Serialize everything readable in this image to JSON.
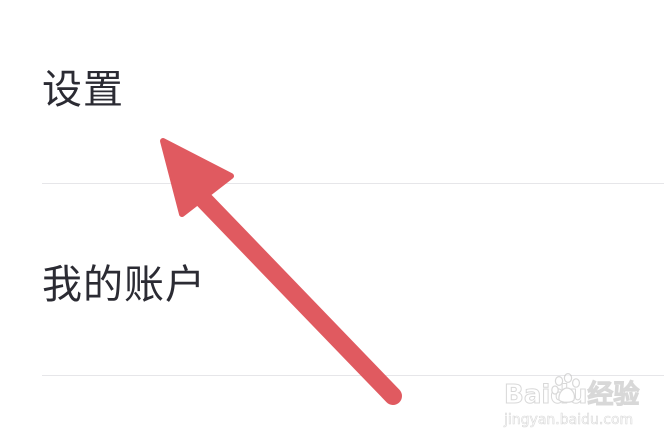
{
  "menu": {
    "items": [
      {
        "label": "设置"
      },
      {
        "label": "我的账户"
      }
    ]
  },
  "annotation": {
    "arrow_color": "#e05a60"
  },
  "watermark": {
    "brand_text": "Baidu经验",
    "url_text": "jingyan.baidu.com"
  },
  "colors": {
    "background": "#ffffff",
    "text": "#2b2b33",
    "divider": "#e6e6e9"
  }
}
